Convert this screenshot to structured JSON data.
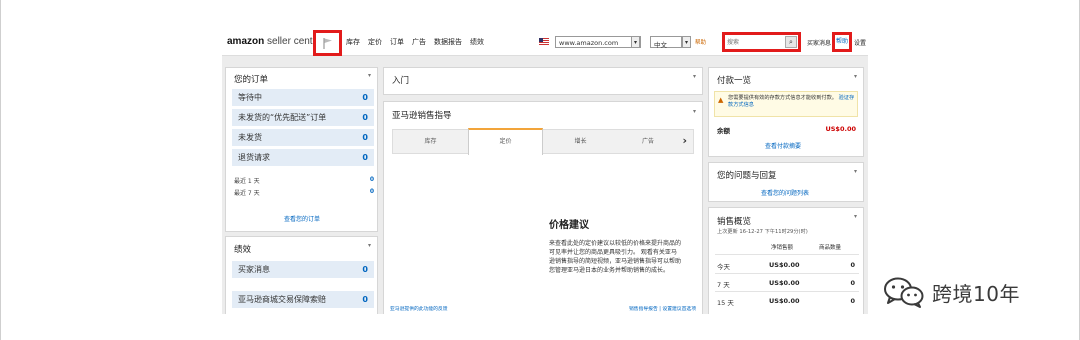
{
  "header": {
    "logo_main": "amazon",
    "logo_sub": " seller central",
    "nav": [
      "库存",
      "定价",
      "订单",
      "广告",
      "数据报告",
      "绩效"
    ],
    "marketplace": "www.amazon.com",
    "language": "中文",
    "help_link": "帮助",
    "search_placeholder": "搜索",
    "buyer_messages": "买家消息",
    "settings": "设置"
  },
  "orders": {
    "title": "您的订单",
    "rows": [
      {
        "label": "等待中",
        "count": "0"
      },
      {
        "label": "未发货的“优先配送”订单",
        "count": "0"
      },
      {
        "label": "未发货",
        "count": "0"
      },
      {
        "label": "退货请求",
        "count": "0"
      }
    ],
    "last1_label": "最近 1 天",
    "last1_count": "0",
    "last7_label": "最近 7 天",
    "last7_count": "0",
    "view_link": "查看您的订单"
  },
  "performance": {
    "title": "绩效",
    "rows": [
      {
        "label": "买家消息",
        "count": "0"
      },
      {
        "label": "亚马逊商城交易保障索赔",
        "count": "0"
      }
    ]
  },
  "intro": {
    "title": "入门"
  },
  "guide": {
    "title": "亚马逊销售指导",
    "tabs": [
      "库存",
      "定价",
      "增长",
      "广告"
    ],
    "active_tab": 1,
    "heading": "价格建议",
    "body": "来查看此处的定价建议以较低的价格来提升商品的可见率并让您的商品更具吸引力。 观看有关亚马逊销售指导的简短视频，亚马逊销售指导可以帮助您管理亚马逊日本的业务并帮助销售的成长。",
    "footer_left": "亚马逊提供的此功能的反馈",
    "footer_right": "销售指导报告 | 设置建议首选项"
  },
  "payments": {
    "title": "付款一览",
    "warning": "您需要提供有效的存款方式信息才能收到付款。",
    "warning_link": "验证存款方式信息",
    "balance_label": "余额",
    "balance_value": "US$0.00",
    "view_link": "查看付款摘要"
  },
  "issues": {
    "title": "您的问题与回复",
    "view_link": "查看您的问题列表"
  },
  "sales": {
    "title": "销售概览",
    "updated": "上次更新 16-12-27 下午11时29分(时)",
    "col_sales": "净销售额",
    "col_qty": "商品数量",
    "rows": [
      {
        "label": "今天",
        "sales": "US$0.00",
        "qty": "0"
      },
      {
        "label": "7 天",
        "sales": "US$0.00",
        "qty": "0"
      },
      {
        "label": "15 天",
        "sales": "US$0.00",
        "qty": "0"
      }
    ]
  },
  "watermark": {
    "text": "跨境10年"
  },
  "colors": {
    "highlight": "#e21b1b",
    "link": "#0066c0",
    "row_bg": "#e3ecf6",
    "tab_accent": "#f2a43a"
  }
}
